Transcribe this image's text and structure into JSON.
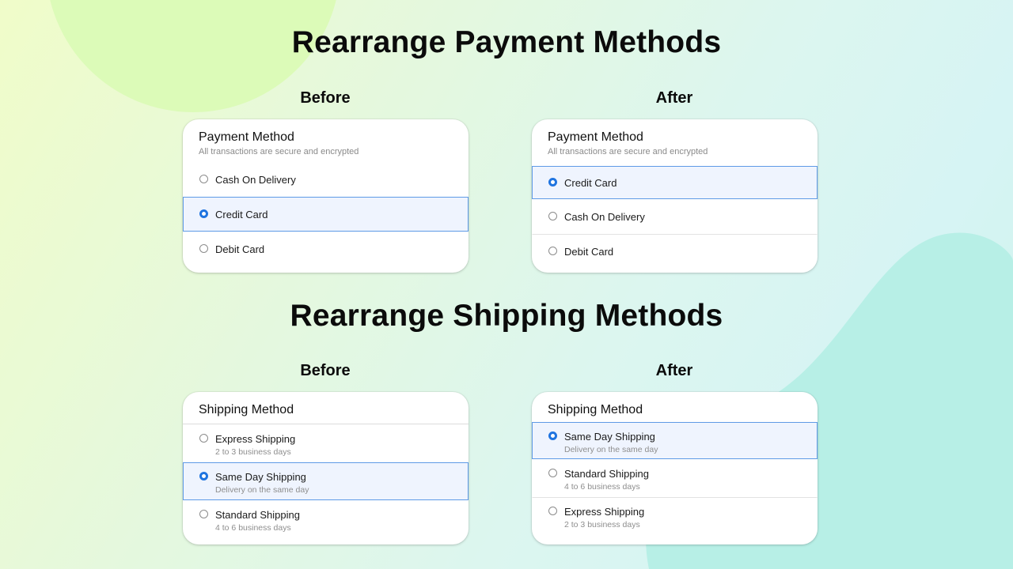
{
  "colors": {
    "accent": "#1f74e0",
    "selected_bg": "#eff4fe",
    "selected_border": "#5e9ae6",
    "text": "#111111",
    "muted": "#8a8a8a"
  },
  "payment": {
    "heading": "Rearrange Payment Methods",
    "before": {
      "label": "Before",
      "card_title": "Payment Method",
      "card_subtitle": "All transactions are secure and encrypted",
      "options": [
        {
          "label": "Cash On Delivery",
          "selected": false
        },
        {
          "label": "Credit Card",
          "selected": true
        },
        {
          "label": "Debit Card",
          "selected": false
        }
      ]
    },
    "after": {
      "label": "After",
      "card_title": "Payment Method",
      "card_subtitle": "All transactions are secure and encrypted",
      "options": [
        {
          "label": "Credit Card",
          "selected": true
        },
        {
          "label": "Cash On Delivery",
          "selected": false
        },
        {
          "label": "Debit Card",
          "selected": false
        }
      ]
    }
  },
  "shipping": {
    "heading": "Rearrange Shipping Methods",
    "before": {
      "label": "Before",
      "card_title": "Shipping Method",
      "options": [
        {
          "label": "Express Shipping",
          "desc": "2 to 3 business days",
          "selected": false
        },
        {
          "label": "Same Day Shipping",
          "desc": "Delivery on the same day",
          "selected": true
        },
        {
          "label": "Standard Shipping",
          "desc": "4 to 6 business days",
          "selected": false
        }
      ]
    },
    "after": {
      "label": "After",
      "card_title": "Shipping Method",
      "options": [
        {
          "label": "Same Day Shipping",
          "desc": "Delivery on the same day",
          "selected": true
        },
        {
          "label": "Standard Shipping",
          "desc": "4 to 6 business days",
          "selected": false
        },
        {
          "label": "Express Shipping",
          "desc": "2 to 3 business days",
          "selected": false
        }
      ]
    }
  }
}
